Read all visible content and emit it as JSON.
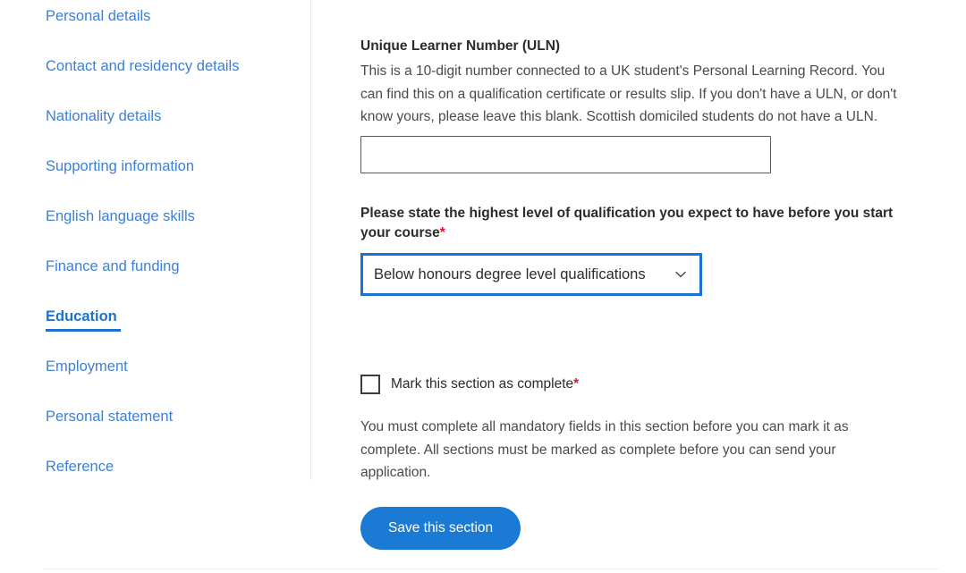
{
  "sidebar": {
    "items": [
      {
        "label": "Personal details",
        "active": false
      },
      {
        "label": "Contact and residency details",
        "active": false
      },
      {
        "label": "Nationality details",
        "active": false
      },
      {
        "label": "Supporting information",
        "active": false
      },
      {
        "label": "English language skills",
        "active": false
      },
      {
        "label": "Finance and funding",
        "active": false
      },
      {
        "label": "Education",
        "active": true
      },
      {
        "label": "Employment",
        "active": false
      },
      {
        "label": "Personal statement",
        "active": false
      },
      {
        "label": "Reference",
        "active": false
      }
    ]
  },
  "form": {
    "uln": {
      "title": "Unique Learner Number (ULN)",
      "description": "This is a 10-digit number connected to a UK student's Personal Learning Record. You can find this on a qualification certificate or results slip. If you don't have a ULN, or don't know yours, please leave this blank. Scottish domiciled students do not have a ULN.",
      "value": "",
      "placeholder": ""
    },
    "qualification": {
      "label": "Please state the highest level of qualification you expect to have before you start your course",
      "required_marker": "*",
      "selected": "Below honours degree level qualifications",
      "chevron_icon": "chevron-down-icon"
    },
    "mark_complete": {
      "label": "Mark this section as complete",
      "required_marker": "*",
      "checked": false,
      "help_text": "You must complete all mandatory fields in this section before you can mark it as complete. All sections must be marked as complete before you can send your application."
    },
    "save_button": "Save this section"
  },
  "colors": {
    "link_blue": "#3e7fd0",
    "active_blue": "#1a73d0",
    "button_blue": "#1a7ad4",
    "required_red": "#e8112d",
    "text_dark": "#2b2b2b"
  }
}
